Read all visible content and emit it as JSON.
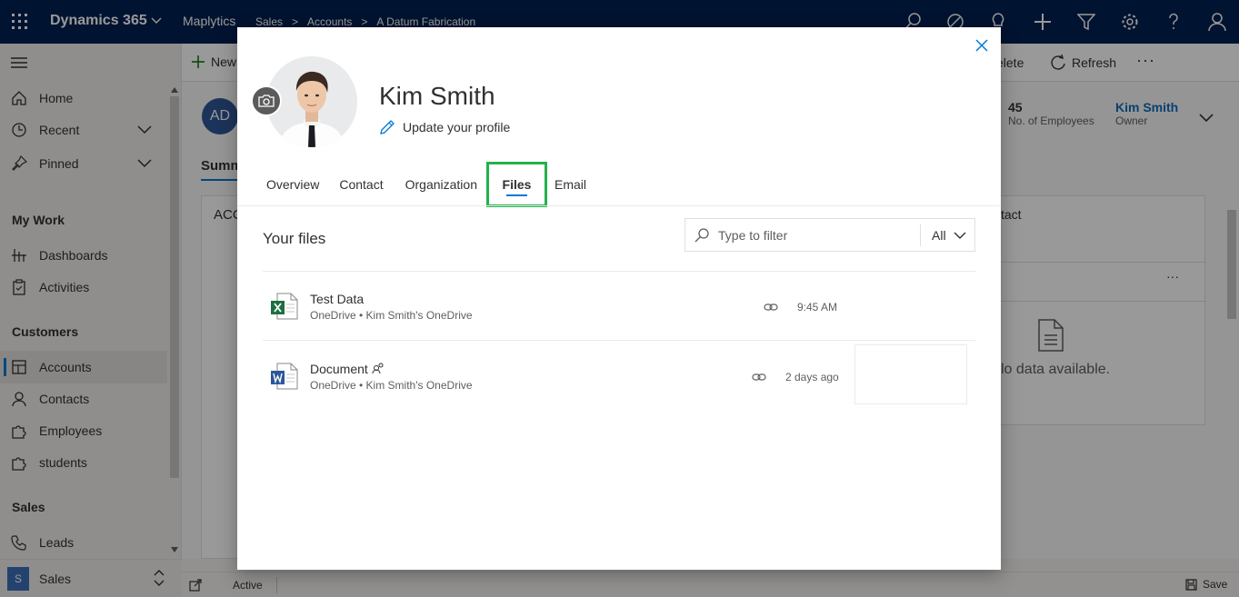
{
  "topbar": {
    "app_title": "Dynamics 365",
    "app_name": "Maplytics",
    "breadcrumbs": [
      "Sales",
      "Accounts",
      "A Datum Fabrication"
    ]
  },
  "commandbar": {
    "new_label": "New",
    "delete_label": "elete",
    "refresh_label": "Refresh",
    "more_label": "···"
  },
  "sidebar": {
    "top_items": [
      {
        "label": "Home",
        "icon": "home-icon"
      },
      {
        "label": "Recent",
        "icon": "clock-icon"
      },
      {
        "label": "Pinned",
        "icon": "pin-icon"
      }
    ],
    "groups": [
      {
        "title": "My Work",
        "items": [
          {
            "label": "Dashboards"
          },
          {
            "label": "Activities"
          }
        ]
      },
      {
        "title": "Customers",
        "items": [
          {
            "label": "Accounts",
            "active": true
          },
          {
            "label": "Contacts"
          },
          {
            "label": "Employees"
          },
          {
            "label": "students"
          }
        ]
      },
      {
        "title": "Sales",
        "items": [
          {
            "label": "Leads"
          }
        ]
      }
    ],
    "area": {
      "badge": "S",
      "label": "Sales"
    }
  },
  "background_form": {
    "avatar_initials": "AD",
    "summary_tab": "Summ",
    "left_card_title": "ACC",
    "employees_value": "45",
    "employees_label": "No. of Employees",
    "owner_value": "Kim Smith",
    "owner_label": "Owner",
    "right_card_title": "tact",
    "right_card_more": "···",
    "no_data": "lo data available."
  },
  "statusbar": {
    "status": "Active",
    "save_label": "Save"
  },
  "dialog": {
    "name": "Kim Smith",
    "update_profile": "Update your profile",
    "tabs": [
      "Overview",
      "Contact",
      "Organization",
      "Files",
      "Email"
    ],
    "selected_tab": "Files",
    "files_title": "Your files",
    "filter_placeholder": "Type to filter",
    "filter_option": "All",
    "files": [
      {
        "name": "Test Data",
        "location": "OneDrive • Kim Smith's OneDrive",
        "time": "9:45 AM",
        "type": "excel",
        "shared": false
      },
      {
        "name": "Document",
        "location": "OneDrive • Kim Smith's OneDrive",
        "time": "2 days ago",
        "type": "word",
        "shared": true
      }
    ]
  },
  "colors": {
    "topbar": "#002050",
    "accent": "#0078d4",
    "highlight": "#22b24c",
    "excel": "#1d6f42",
    "word": "#2b579a"
  }
}
